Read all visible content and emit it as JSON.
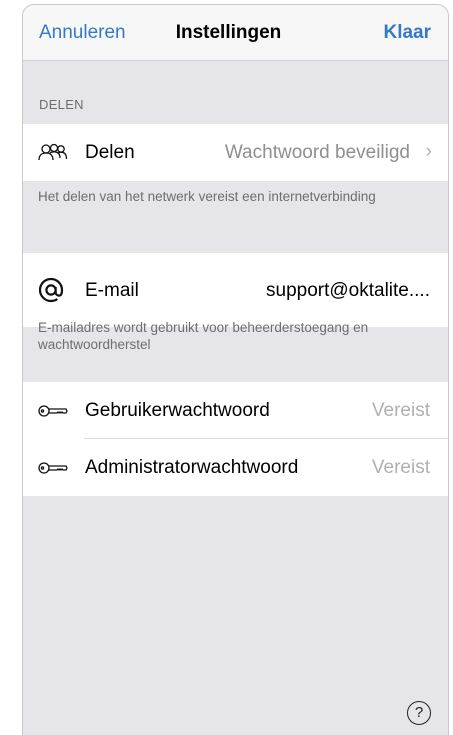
{
  "navbar": {
    "cancel_label": "Annuleren",
    "title": "Instellingen",
    "done_label": "Klaar"
  },
  "sections": {
    "sharing": {
      "header": "DELEN",
      "row": {
        "icon": "people-icon",
        "label": "Delen",
        "value": "Wachtwoord beveiligd",
        "accessory": "›"
      },
      "footer": "Het delen van het netwerk vereist een internetverbinding"
    },
    "email": {
      "row": {
        "icon": "at-sign-icon",
        "label": "E-mail",
        "value": "support@oktalite...."
      },
      "footer": "E-mailadres wordt gebruikt voor beheerderstoegang en wachtwoordherstel"
    },
    "passwords": {
      "rows": [
        {
          "icon": "key-icon",
          "label": "Gebruikerwachtwoord",
          "value": "Vereist"
        },
        {
          "icon": "key-icon",
          "label": "Administratorwachtwoord",
          "value": "Vereist"
        }
      ]
    }
  },
  "help": {
    "icon": "help-icon",
    "glyph": "?"
  },
  "colors": {
    "accent": "#3478c7",
    "background": "#e5e5ea",
    "secondary_text": "#6d6d72",
    "placeholder_text": "#b0b0b4"
  }
}
